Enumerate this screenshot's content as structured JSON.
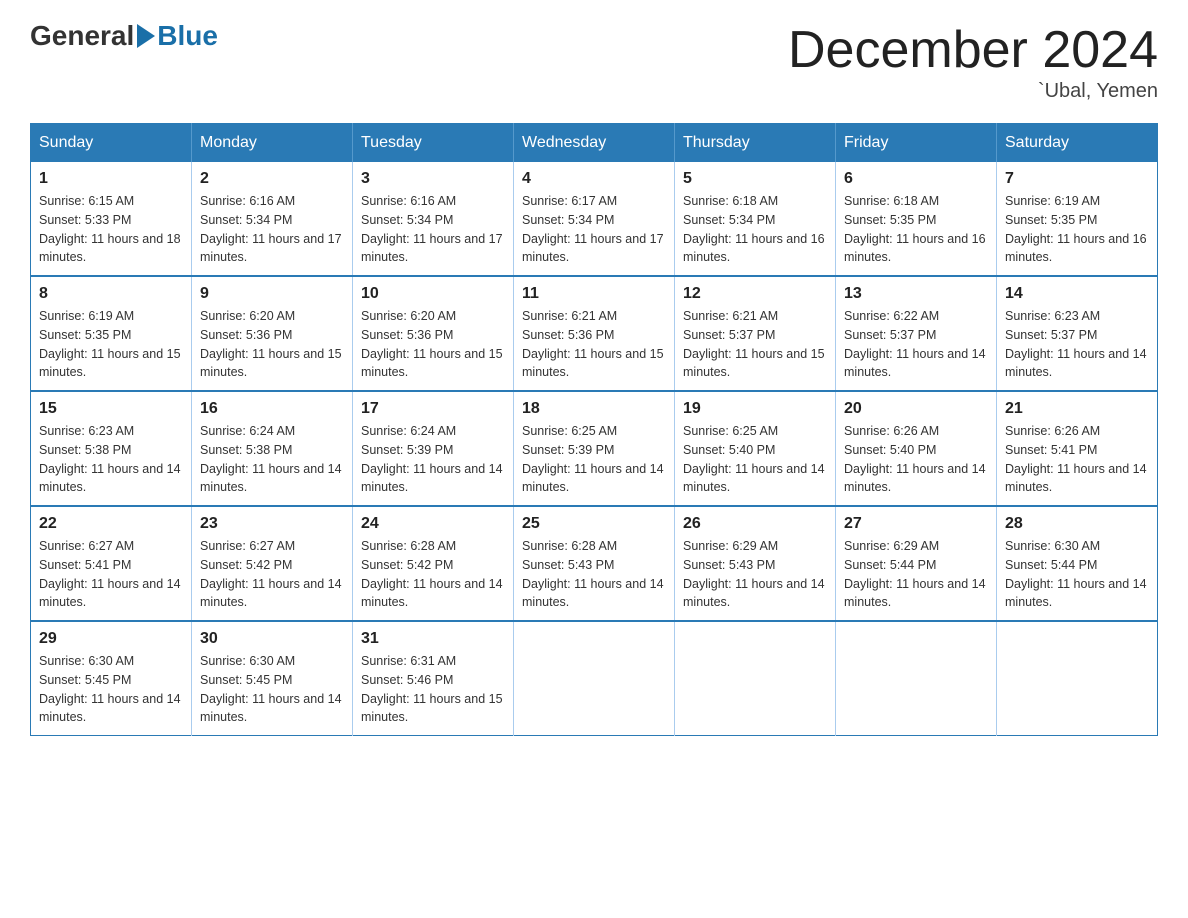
{
  "header": {
    "logo_general": "General",
    "logo_blue": "Blue",
    "title": "December 2024",
    "location": "`Ubal, Yemen"
  },
  "days_of_week": [
    "Sunday",
    "Monday",
    "Tuesday",
    "Wednesday",
    "Thursday",
    "Friday",
    "Saturday"
  ],
  "weeks": [
    [
      {
        "day": "1",
        "sunrise": "6:15 AM",
        "sunset": "5:33 PM",
        "daylight": "11 hours and 18 minutes."
      },
      {
        "day": "2",
        "sunrise": "6:16 AM",
        "sunset": "5:34 PM",
        "daylight": "11 hours and 17 minutes."
      },
      {
        "day": "3",
        "sunrise": "6:16 AM",
        "sunset": "5:34 PM",
        "daylight": "11 hours and 17 minutes."
      },
      {
        "day": "4",
        "sunrise": "6:17 AM",
        "sunset": "5:34 PM",
        "daylight": "11 hours and 17 minutes."
      },
      {
        "day": "5",
        "sunrise": "6:18 AM",
        "sunset": "5:34 PM",
        "daylight": "11 hours and 16 minutes."
      },
      {
        "day": "6",
        "sunrise": "6:18 AM",
        "sunset": "5:35 PM",
        "daylight": "11 hours and 16 minutes."
      },
      {
        "day": "7",
        "sunrise": "6:19 AM",
        "sunset": "5:35 PM",
        "daylight": "11 hours and 16 minutes."
      }
    ],
    [
      {
        "day": "8",
        "sunrise": "6:19 AM",
        "sunset": "5:35 PM",
        "daylight": "11 hours and 15 minutes."
      },
      {
        "day": "9",
        "sunrise": "6:20 AM",
        "sunset": "5:36 PM",
        "daylight": "11 hours and 15 minutes."
      },
      {
        "day": "10",
        "sunrise": "6:20 AM",
        "sunset": "5:36 PM",
        "daylight": "11 hours and 15 minutes."
      },
      {
        "day": "11",
        "sunrise": "6:21 AM",
        "sunset": "5:36 PM",
        "daylight": "11 hours and 15 minutes."
      },
      {
        "day": "12",
        "sunrise": "6:21 AM",
        "sunset": "5:37 PM",
        "daylight": "11 hours and 15 minutes."
      },
      {
        "day": "13",
        "sunrise": "6:22 AM",
        "sunset": "5:37 PM",
        "daylight": "11 hours and 14 minutes."
      },
      {
        "day": "14",
        "sunrise": "6:23 AM",
        "sunset": "5:37 PM",
        "daylight": "11 hours and 14 minutes."
      }
    ],
    [
      {
        "day": "15",
        "sunrise": "6:23 AM",
        "sunset": "5:38 PM",
        "daylight": "11 hours and 14 minutes."
      },
      {
        "day": "16",
        "sunrise": "6:24 AM",
        "sunset": "5:38 PM",
        "daylight": "11 hours and 14 minutes."
      },
      {
        "day": "17",
        "sunrise": "6:24 AM",
        "sunset": "5:39 PM",
        "daylight": "11 hours and 14 minutes."
      },
      {
        "day": "18",
        "sunrise": "6:25 AM",
        "sunset": "5:39 PM",
        "daylight": "11 hours and 14 minutes."
      },
      {
        "day": "19",
        "sunrise": "6:25 AM",
        "sunset": "5:40 PM",
        "daylight": "11 hours and 14 minutes."
      },
      {
        "day": "20",
        "sunrise": "6:26 AM",
        "sunset": "5:40 PM",
        "daylight": "11 hours and 14 minutes."
      },
      {
        "day": "21",
        "sunrise": "6:26 AM",
        "sunset": "5:41 PM",
        "daylight": "11 hours and 14 minutes."
      }
    ],
    [
      {
        "day": "22",
        "sunrise": "6:27 AM",
        "sunset": "5:41 PM",
        "daylight": "11 hours and 14 minutes."
      },
      {
        "day": "23",
        "sunrise": "6:27 AM",
        "sunset": "5:42 PM",
        "daylight": "11 hours and 14 minutes."
      },
      {
        "day": "24",
        "sunrise": "6:28 AM",
        "sunset": "5:42 PM",
        "daylight": "11 hours and 14 minutes."
      },
      {
        "day": "25",
        "sunrise": "6:28 AM",
        "sunset": "5:43 PM",
        "daylight": "11 hours and 14 minutes."
      },
      {
        "day": "26",
        "sunrise": "6:29 AM",
        "sunset": "5:43 PM",
        "daylight": "11 hours and 14 minutes."
      },
      {
        "day": "27",
        "sunrise": "6:29 AM",
        "sunset": "5:44 PM",
        "daylight": "11 hours and 14 minutes."
      },
      {
        "day": "28",
        "sunrise": "6:30 AM",
        "sunset": "5:44 PM",
        "daylight": "11 hours and 14 minutes."
      }
    ],
    [
      {
        "day": "29",
        "sunrise": "6:30 AM",
        "sunset": "5:45 PM",
        "daylight": "11 hours and 14 minutes."
      },
      {
        "day": "30",
        "sunrise": "6:30 AM",
        "sunset": "5:45 PM",
        "daylight": "11 hours and 14 minutes."
      },
      {
        "day": "31",
        "sunrise": "6:31 AM",
        "sunset": "5:46 PM",
        "daylight": "11 hours and 15 minutes."
      },
      null,
      null,
      null,
      null
    ]
  ],
  "cell_labels": {
    "sunrise": "Sunrise:",
    "sunset": "Sunset:",
    "daylight": "Daylight:"
  }
}
